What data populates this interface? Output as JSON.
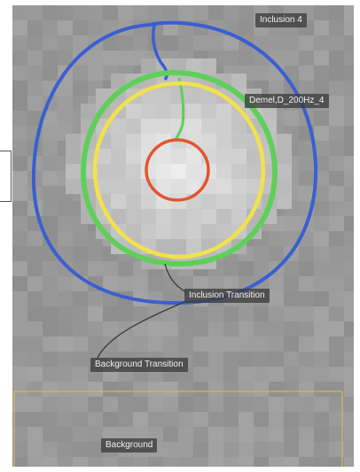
{
  "labels": {
    "inclusion": "Inclusion 4",
    "probe": "Demel,D_200Hz_4",
    "inclusion_transition": "Inclusion Transition",
    "background_transition": "Background Transition",
    "background": "Background"
  },
  "colors": {
    "image_background": "#9a9a9a",
    "outer_ring": "#3a5fd0",
    "green_ring": "#5fcf5a",
    "yellow_ring": "#f2e24a",
    "inner_ring": "#e2552f",
    "roi_box": "#d9b75a",
    "label_bg": "#3c3c3c",
    "label_text": "#f2f2f2"
  }
}
